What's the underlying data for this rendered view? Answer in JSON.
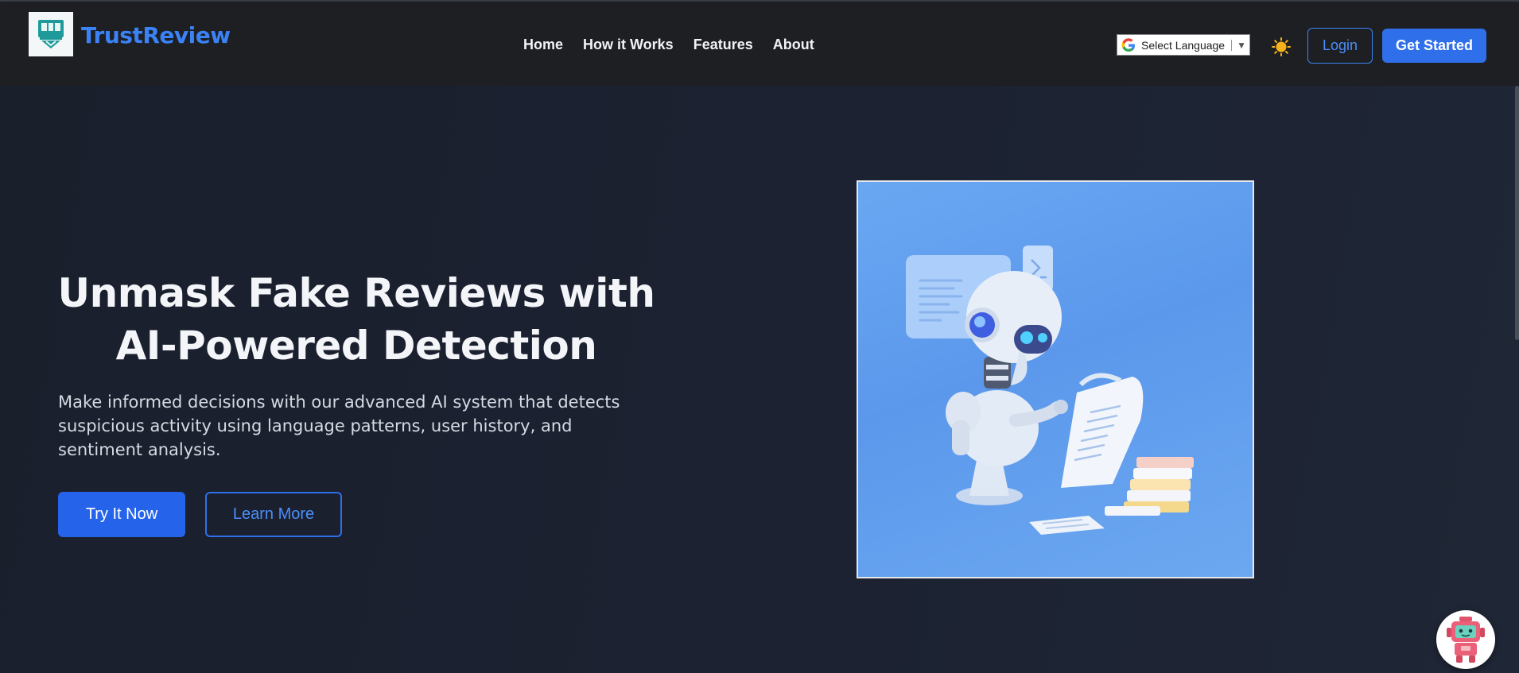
{
  "header": {
    "brand": "TrustReview",
    "logo_icon": "shield-logo-icon",
    "nav": [
      {
        "label": "Home"
      },
      {
        "label": "How it Works"
      },
      {
        "label": "Features"
      },
      {
        "label": "About"
      }
    ],
    "language_select": {
      "label": "Select Language",
      "icon": "google-g-icon"
    },
    "theme_toggle_icon": "sun-icon",
    "login_label": "Login",
    "get_started_label": "Get Started"
  },
  "hero": {
    "title": "Unmask Fake Reviews with AI-Powered Detection",
    "subtitle": "Make informed decisions with our advanced AI system that detects suspicious activity using language patterns, user history, and sentiment analysis.",
    "primary_cta": "Try It Now",
    "secondary_cta": "Learn More",
    "image_icon": "robot-reading-document-illustration"
  },
  "chatbot": {
    "icon": "robot-chat-icon"
  },
  "colors": {
    "accent": "#3b82f6",
    "primary_button": "#2563eb",
    "navbar_bg": "#1d1f22",
    "hero_bg": "#1b2130",
    "image_bg": "#5b98ec"
  }
}
